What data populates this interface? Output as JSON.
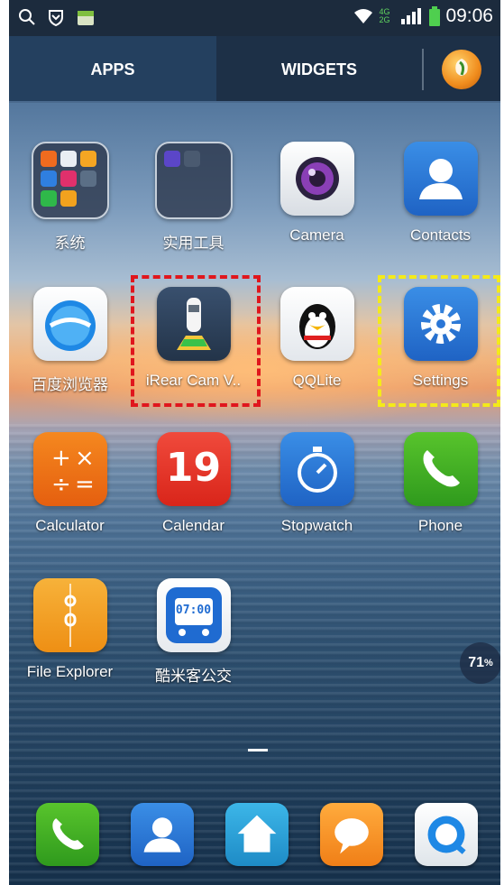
{
  "status_bar": {
    "network_label": "4G 2G",
    "time": "09:06"
  },
  "tabs": {
    "apps": "APPS",
    "widgets": "WIDGETS"
  },
  "apps": {
    "row1": [
      "系统",
      "实用工具",
      "Camera",
      "Contacts"
    ],
    "row2": [
      "百度浏览器",
      "iRear Cam V..",
      "QQLite",
      "Settings"
    ],
    "row3": [
      "Calculator",
      "Calendar",
      "Stopwatch",
      "Phone"
    ],
    "row4": [
      "File Explorer",
      "酷米客公交"
    ]
  },
  "calendar_day": "19",
  "bus_time": "07:00",
  "battery_badge": {
    "value": "71",
    "unit": "%"
  },
  "highlight_colors": {
    "red_box": "#e0161d",
    "yellow_box": "#f4ea1a"
  },
  "dock_icons": [
    "phone-icon",
    "contacts-icon",
    "home-icon",
    "message-icon",
    "browser-icon"
  ]
}
